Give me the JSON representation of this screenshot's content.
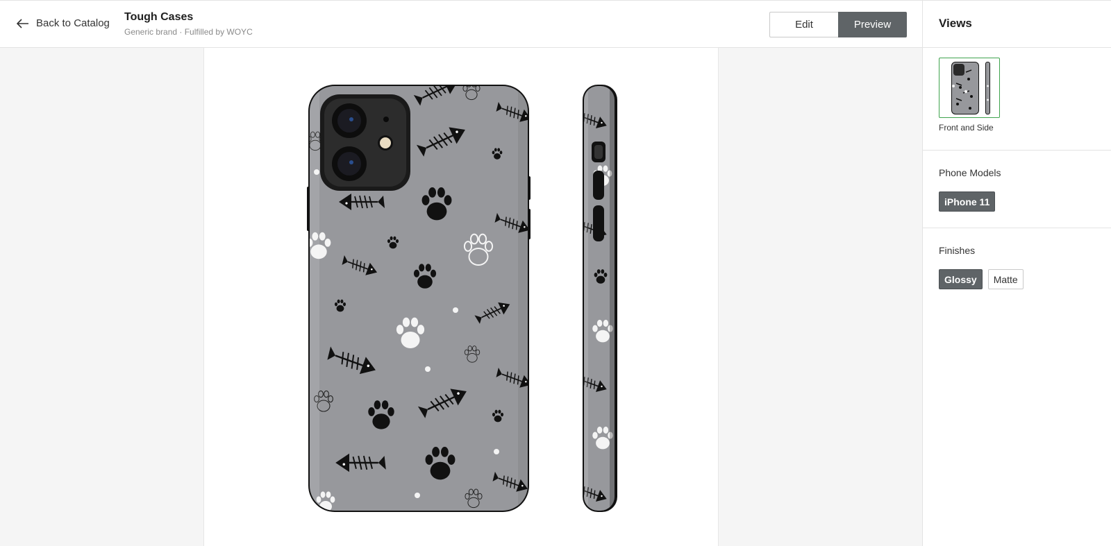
{
  "header": {
    "back_label": "Back to Catalog",
    "title": "Tough Cases",
    "subtitle": "Generic brand · Fulfilled by WOYC",
    "modes": {
      "edit": "Edit",
      "preview": "Preview",
      "active": "Preview"
    }
  },
  "sidebar": {
    "title": "Views",
    "views": [
      {
        "label": "Front and Side",
        "selected": true
      }
    ],
    "phone_models": {
      "title": "Phone Models",
      "options": [
        {
          "label": "iPhone 11",
          "selected": true
        }
      ]
    },
    "finishes": {
      "title": "Finishes",
      "options": [
        {
          "label": "Glossy",
          "selected": true
        },
        {
          "label": "Matte",
          "selected": false
        }
      ]
    }
  },
  "preview": {
    "view": "Front and Side",
    "case_color": "#97989c",
    "pattern": "black fish-bones and paws with white paws",
    "selected_color": "#5f6467",
    "accent_border": "#3fa34d"
  }
}
